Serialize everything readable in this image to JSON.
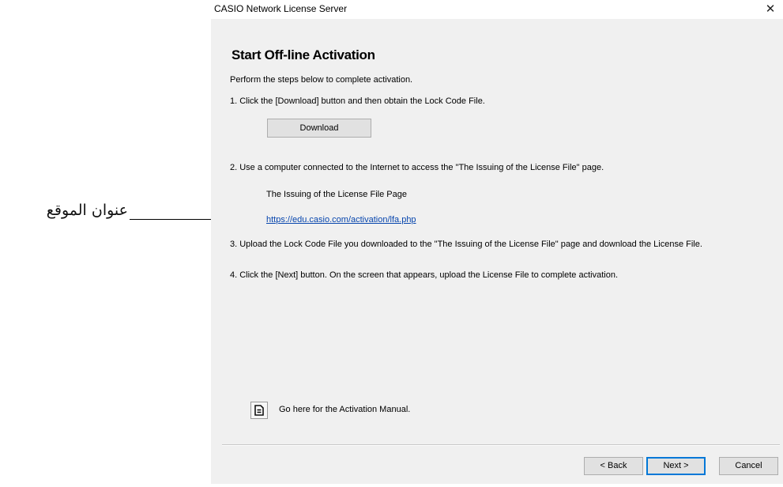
{
  "annotation": {
    "callout_text": "عنوان الموقع"
  },
  "window": {
    "title": "CASIO Network License Server",
    "close_glyph": "✕"
  },
  "page": {
    "heading": "Start Off-line Activation",
    "intro": "Perform the steps below to complete activation.",
    "step1": "1. Click the [Download] button and then obtain the Lock Code File.",
    "download_label": "Download",
    "step2": "2. Use a computer connected to the Internet to access the \"The Issuing of the License File\" page.",
    "issuing_title": "The Issuing of the License File Page",
    "issuing_url": "https://edu.casio.com/activation/lfa.php",
    "step3": "3. Upload the Lock Code File you downloaded to the \"The Issuing of the License File\" page and download the License File.",
    "step4": "4. Click the [Next] button. On the screen that appears, upload the License File to complete activation.",
    "manual_icon": "document-icon",
    "manual_text": "Go here for the Activation Manual."
  },
  "footer": {
    "back_label": "< Back",
    "next_label": "Next >",
    "cancel_label": "Cancel"
  },
  "colors": {
    "dialog_bg": "#f0f0f0",
    "link": "#0645ad",
    "default_button_border": "#0078d7"
  }
}
